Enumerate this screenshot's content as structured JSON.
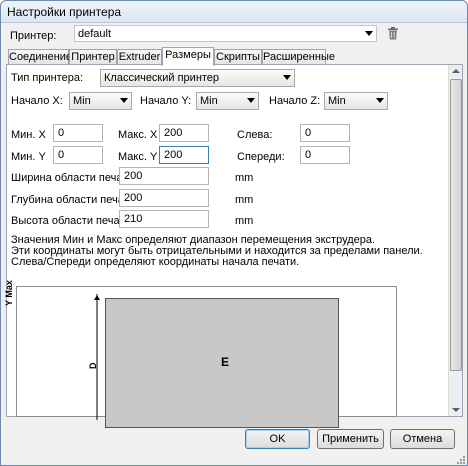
{
  "window": {
    "title": "Настройки принтера"
  },
  "printer": {
    "label": "Принтер:",
    "value": "default",
    "delete_icon": "trash-icon"
  },
  "tabs": [
    {
      "label": "Соединение"
    },
    {
      "label": "Принтер"
    },
    {
      "label": "Extruder"
    },
    {
      "label": "Размеры",
      "active": true
    },
    {
      "label": "Скрипты"
    },
    {
      "label": "Расширенные"
    }
  ],
  "form": {
    "printer_type_label": "Тип принтера:",
    "printer_type_value": "Классический принтер",
    "start_x_label": "Начало X:",
    "start_x_value": "Min",
    "start_y_label": "Начало Y:",
    "start_y_value": "Min",
    "start_z_label": "Начало Z:",
    "start_z_value": "Min",
    "min_x_label": "Мин. X",
    "min_x_value": "0",
    "max_x_label": "Макс. X",
    "max_x_value": "200",
    "left_label": "Слева:",
    "left_value": "0",
    "min_y_label": "Мин. Y",
    "min_y_value": "0",
    "max_y_label": "Макс. Y",
    "max_y_value": "200",
    "front_label": "Спереди:",
    "front_value": "0",
    "width_label": "Ширина области печати:",
    "width_value": "200",
    "width_unit": "mm",
    "depth_label": "Глубина области печати:",
    "depth_value": "200",
    "depth_unit": "mm",
    "height_label": "Высота области печати:",
    "height_value": "210",
    "height_unit": "mm",
    "note_line1": "Значения Мин и Макс определяют диапазон перемещения экструдера.",
    "note_line2": "Эти координаты могут быть отрицательными и находится за пределами панели.",
    "note_line3": "Слева/Спереди определяют координаты начала печати."
  },
  "diagram": {
    "y_axis_label": "Y Max",
    "d_label": "D",
    "e_label": "E"
  },
  "buttons": {
    "ok": "OK",
    "apply": "Применить",
    "cancel": "Отмена"
  }
}
